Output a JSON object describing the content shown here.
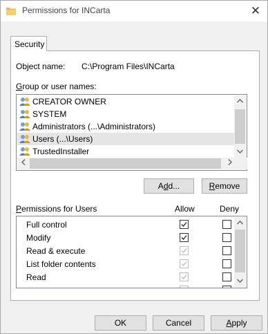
{
  "window": {
    "title": "Permissions for INCarta",
    "close_glyph": "✕",
    "icon": "folder-icon"
  },
  "tabs": [
    {
      "label": "Security",
      "active": true
    }
  ],
  "object": {
    "label": "Object name:",
    "value": "C:\\Program Files\\INCarta"
  },
  "group_section": {
    "label": "Group or user names:",
    "users": [
      {
        "name": "CREATOR OWNER",
        "selected": false
      },
      {
        "name": "SYSTEM",
        "selected": false
      },
      {
        "name": "Administrators (...\\Administrators)",
        "selected": false
      },
      {
        "name": "Users (...\\Users)",
        "selected": true
      },
      {
        "name": "TrustedInstaller",
        "selected": false
      }
    ],
    "add_label": "Add...",
    "remove_label": "Remove"
  },
  "permissions": {
    "label": "Permissions for Users",
    "allow_header": "Allow",
    "deny_header": "Deny",
    "items": [
      {
        "name": "Full control",
        "allow": true,
        "allow_enabled": true,
        "deny": false
      },
      {
        "name": "Modify",
        "allow": true,
        "allow_enabled": true,
        "deny": false
      },
      {
        "name": "Read & execute",
        "allow": true,
        "allow_enabled": false,
        "deny": false
      },
      {
        "name": "List folder contents",
        "allow": true,
        "allow_enabled": false,
        "deny": false
      },
      {
        "name": "Read",
        "allow": true,
        "allow_enabled": false,
        "deny": false
      }
    ]
  },
  "buttons": {
    "ok": "OK",
    "cancel": "Cancel",
    "apply": "Apply"
  },
  "colors": {
    "selection": "#e5e5e5",
    "button_face": "#e1e1e1",
    "folder": "#e8b84a"
  }
}
